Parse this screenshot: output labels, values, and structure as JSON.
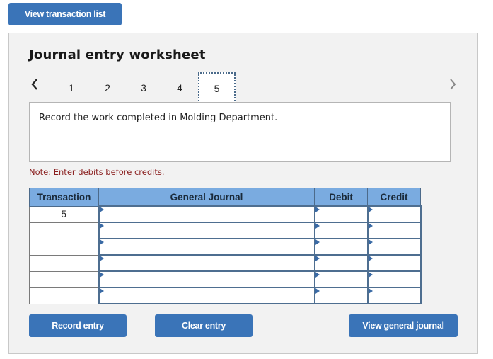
{
  "top_button": {
    "label": "View transaction list"
  },
  "worksheet": {
    "title": "Journal entry worksheet",
    "nav": {
      "prev_icon": "chevron-left-icon",
      "next_icon": "chevron-right-icon",
      "tabs": [
        "1",
        "2",
        "3",
        "4",
        "5"
      ],
      "active_tab": "5"
    },
    "description": "Record the work completed in Molding Department.",
    "note": "Note: Enter debits before credits.",
    "table": {
      "headers": [
        "Transaction",
        "General Journal",
        "Debit",
        "Credit"
      ],
      "rows": [
        {
          "transaction": "5",
          "account": "",
          "debit": "",
          "credit": ""
        },
        {
          "transaction": "",
          "account": "",
          "debit": "",
          "credit": ""
        },
        {
          "transaction": "",
          "account": "",
          "debit": "",
          "credit": ""
        },
        {
          "transaction": "",
          "account": "",
          "debit": "",
          "credit": ""
        },
        {
          "transaction": "",
          "account": "",
          "debit": "",
          "credit": ""
        },
        {
          "transaction": "",
          "account": "",
          "debit": "",
          "credit": ""
        }
      ]
    },
    "buttons": {
      "record": "Record entry",
      "clear": "Clear entry",
      "view_general_journal": "View general journal"
    }
  },
  "colors": {
    "button_bg": "#3a74b8",
    "header_bg": "#7aabe0",
    "note_text": "#8a1f1f",
    "panel_bg": "#f2f2f2"
  }
}
